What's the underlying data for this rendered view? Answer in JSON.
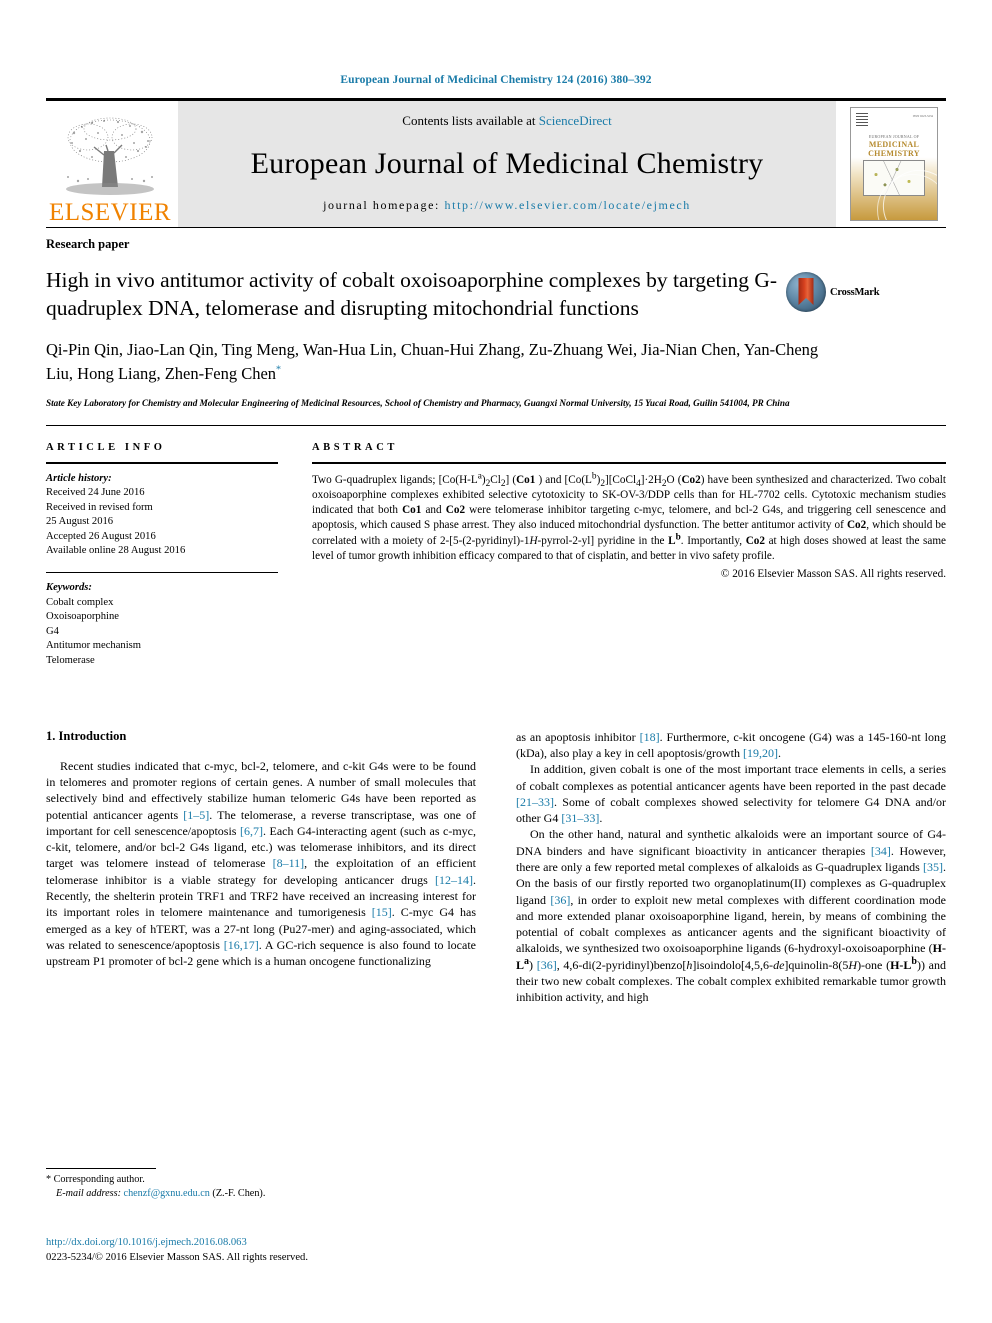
{
  "running_head": "European Journal of Medicinal Chemistry 124 (2016) 380–392",
  "masthead": {
    "publisher_name": "ELSEVIER",
    "contents_prefix": "Contents lists available at ",
    "contents_link": "ScienceDirect",
    "journal_title": "European Journal of Medicinal Chemistry",
    "homepage_prefix": "journal homepage: ",
    "homepage_url": "http://www.elsevier.com/locate/ejmech",
    "cover": {
      "supertitle": "EUROPEAN JOURNAL OF",
      "title_line1": "MEDICINAL",
      "title_line2": "CHEMISTRY",
      "issn_mark": "ISSN 0223-5234"
    }
  },
  "article": {
    "type": "Research paper",
    "title": "High in vivo antitumor activity of cobalt oxoisoaporphine complexes by targeting G-quadruplex DNA, telomerase and disrupting mitochondrial functions",
    "crossmark_label": "CrossMark",
    "authors": "Qi-Pin Qin, Jiao-Lan Qin, Ting Meng, Wan-Hua Lin, Chuan-Hui Zhang, Zu-Zhuang Wei, Jia-Nian Chen, Yan-Cheng Liu, Hong Liang, Zhen-Feng Chen",
    "corresponding_marker": "*",
    "affiliation": "State Key Laboratory for Chemistry and Molecular Engineering of Medicinal Resources, School of Chemistry and Pharmacy, Guangxi Normal University, 15 Yucai Road, Guilin 541004, PR China"
  },
  "article_info": {
    "heading": "ARTICLE INFO",
    "history_label": "Article history:",
    "history": [
      "Received 24 June 2016",
      "Received in revised form",
      "25 August 2016",
      "Accepted 26 August 2016",
      "Available online 28 August 2016"
    ],
    "keywords_label": "Keywords:",
    "keywords": [
      "Cobalt complex",
      "Oxoisoaporphine",
      "G4",
      "Antitumor mechanism",
      "Telomerase"
    ]
  },
  "abstract": {
    "heading": "ABSTRACT",
    "paragraph_1": "Two G-quadruplex ligands; [Co(H-L",
    "text": "Two G-quadruplex ligands; [Co(H-La)2Cl2] (Co1 ) and [Co(Lb)2][CoCl4]·2H2O (Co2) have been synthesized and characterized. Two cobalt oxoisoaporphine complexes exhibited selective cytotoxicity to SK-OV-3/DDP cells than for HL-7702 cells. Cytotoxic mechanism studies indicated that both Co1 and Co2 were telomerase inhibitor targeting c-myc, telomere, and bcl-2 G4s, and triggering cell senescence and apoptosis, which caused S phase arrest. They also induced mitochondrial dysfunction. The better antitumor activity of Co2, which should be correlated with a moiety of 2-[5-(2-pyridinyl)-1H-pyrrol-2-yl] pyridine in the Lb. Importantly, Co2 at high doses showed at least the same level of tumor growth inhibition efficacy compared to that of cisplatin, and better in vivo safety profile.",
    "copyright": "© 2016 Elsevier Masson SAS. All rights reserved."
  },
  "introduction": {
    "heading": "1. Introduction",
    "left_paragraph_1": "Recent studies indicated that c-myc, bcl-2, telomere, and c-kit G4s were to be found in telomeres and promoter regions of certain genes. A number of small molecules that selectively bind and effectively stabilize human telomeric G4s have been reported as potential anticancer agents [1–5]. The telomerase, a reverse transcriptase, was one of important for cell senescence/apoptosis [6,7]. Each G4-interacting agent (such as c-myc, c-kit, telomere, and/or bcl-2 G4s ligand, etc.) was telomerase inhibitors, and its direct target was telomere instead of telomerase [8–11], the exploitation of an efficient telomerase inhibitor is a viable strategy for developing anticancer drugs [12–14]. Recently, the shelterin protein TRF1 and TRF2 have received an increasing interest for its important roles in telomere maintenance and tumorigenesis [15]. C-myc G4 has emerged as a key of hTERT, was a 27-nt long (Pu27-mer) and aging-associated, which was related to senescence/apoptosis [16,17]. A GC-rich sequence is also found to locate upstream P1 promoter of bcl-2 gene which is a human oncogene functionalizing",
    "right_paragraph_1": "as an apoptosis inhibitor [18]. Furthermore, c-kit oncogene (G4) was a 145-160-nt long (kDa), also play a key in cell apoptosis/growth [19,20].",
    "right_paragraph_2": "In addition, given cobalt is one of the most important trace elements in cells, a series of cobalt complexes as potential anticancer agents have been reported in the past decade [21–33]. Some of cobalt complexes showed selectivity for telomere G4 DNA and/or other G4 [31–33].",
    "right_paragraph_3": "On the other hand, natural and synthetic alkaloids were an important source of G4-DNA binders and have significant bioactivity in anticancer therapies [34]. However, there are only a few reported metal complexes of alkaloids as G-quadruplex ligands [35]. On the basis of our firstly reported two organoplatinum(II) complexes as G-quadruplex ligand [36], in order to exploit new metal complexes with different coordination mode and more extended planar oxoisoaporphine ligand, herein, by means of combining the potential of cobalt complexes as anticancer agents and the significant bioactivity of alkaloids, we synthesized two oxoisoaporphine ligands (6-hydroxyl-oxoisoaporphine (H-La) [36], 4,6-di(2-pyridinyl)benzo[h]isoindolo[4,5,6-de]quinolin-8(5H)-one (H-Lb)) and their two new cobalt complexes. The cobalt complex exhibited remarkable tumor growth inhibition activity, and high"
  },
  "footnote": {
    "corresponding_symbol": "*",
    "corresponding_text": "Corresponding author.",
    "email_label": "E-mail address:",
    "email": "chenzf@gxnu.edu.cn",
    "email_suffix": "(Z.-F. Chen)."
  },
  "doi_block": {
    "doi_url": "http://dx.doi.org/10.1016/j.ejmech.2016.08.063",
    "issn_line": "0223-5234/© 2016 Elsevier Masson SAS. All rights reserved."
  },
  "colors": {
    "link_blue": "#1a7ba8",
    "elsevier_orange": "#F08200",
    "band_grey": "#e6e6e6"
  }
}
